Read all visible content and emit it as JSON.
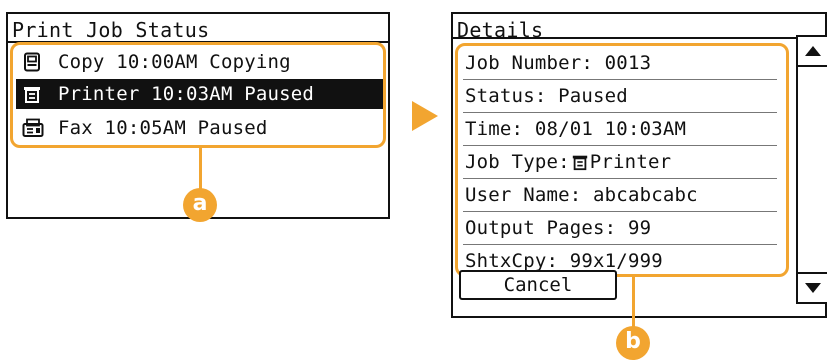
{
  "accent_color": "#f2a530",
  "print_job_status": {
    "title": "Print Job Status",
    "jobs": [
      {
        "icon": "copy-icon",
        "text": "Copy 10:00AM Copying",
        "selected": false
      },
      {
        "icon": "printer-icon",
        "text": "Printer 10:03AM Paused",
        "selected": true
      },
      {
        "icon": "fax-icon",
        "text": "Fax 10:05AM Paused",
        "selected": false
      }
    ]
  },
  "details": {
    "title": "Details",
    "rows": [
      {
        "text": "Job Number: 0013"
      },
      {
        "text": "Status: Paused"
      },
      {
        "text": "Time: 08/01 10:03AM"
      },
      {
        "label": "Job Type:",
        "icon": "printer-icon",
        "value": "Printer"
      },
      {
        "text": "User Name: abcabcabc"
      },
      {
        "text": "Output Pages: 99"
      },
      {
        "text": "ShtxCpy: 99x1/999"
      }
    ],
    "cancel_label": "Cancel",
    "scroll_up_icon": "triangle-up-icon",
    "scroll_down_icon": "triangle-down-icon"
  },
  "callouts": {
    "a": "a",
    "b": "b"
  }
}
